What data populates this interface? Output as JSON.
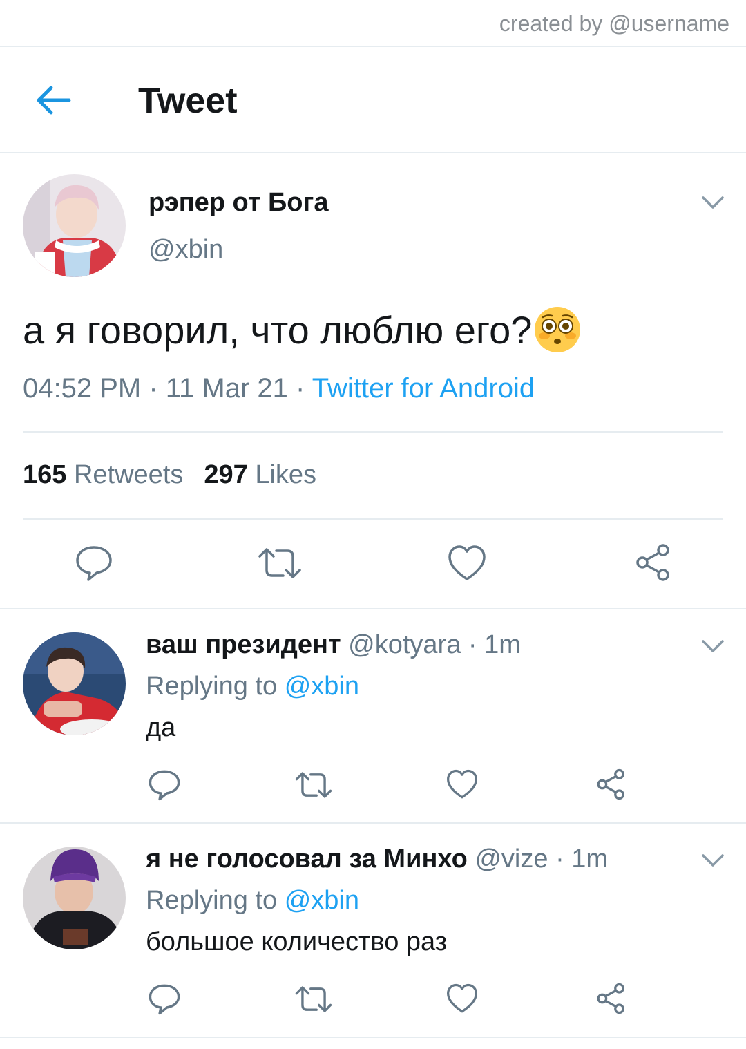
{
  "credit": "created by @username",
  "header": {
    "title": "Tweet",
    "back_icon": "back-arrow-icon"
  },
  "main_tweet": {
    "author_name": "рэпер от Бога",
    "author_handle": "@xbin",
    "text": "а я говорил, что люблю его?",
    "emoji": "flushed-face",
    "time": "04:52 PM",
    "date": "11 Mar 21",
    "source": "Twitter for Android",
    "separator": " · ",
    "retweets_count": "165",
    "retweets_label": "Retweets",
    "likes_count": "297",
    "likes_label": "Likes"
  },
  "replies": [
    {
      "name": "ваш президент",
      "handle": "@kotyara",
      "time": "1m",
      "replying_label": "Replying to",
      "replying_to": "@xbin",
      "text": "да"
    },
    {
      "name": "я не голосовал за Минхо",
      "handle": "@vize",
      "time": "1m",
      "replying_label": "Replying to",
      "replying_to": "@xbin",
      "text": "большое количество раз"
    }
  ],
  "colors": {
    "accent": "#1da1f2",
    "secondary_text": "#657786",
    "divider": "#e6ecf0",
    "back_arrow": "#1b95e0"
  }
}
